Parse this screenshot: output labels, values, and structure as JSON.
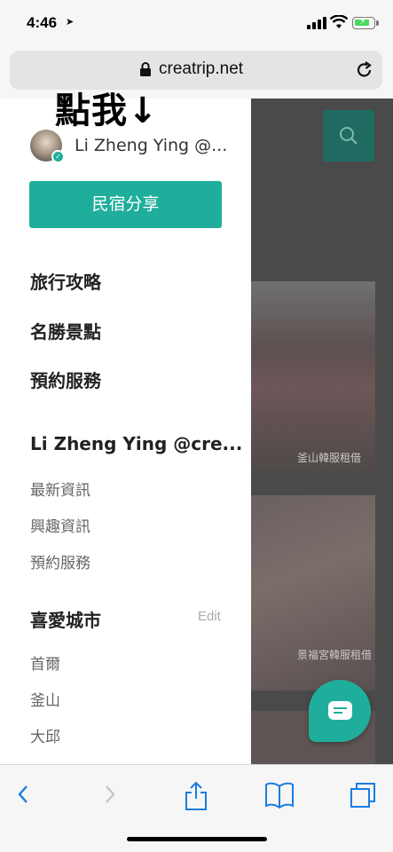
{
  "status_bar": {
    "time": "4:46",
    "battery_level": 0.85,
    "accent_color": "#4cd964"
  },
  "browser": {
    "url": "creatrip.net",
    "lock_icon": "lock-icon",
    "reload_icon": "reload-icon"
  },
  "annotation": "點我↓",
  "drawer": {
    "user_name": "Li Zheng Ying @...",
    "share_button_label": "民宿分享",
    "menu_items": [
      "旅行攻略",
      "名勝景點",
      "預約服務"
    ],
    "account_section": {
      "title": "Li Zheng Ying @cre...",
      "items": [
        "最新資訊",
        "興趣資訊",
        "預約服務"
      ]
    },
    "favorites_section": {
      "title": "喜愛城市",
      "edit_label": "Edit",
      "items": [
        "首爾",
        "釜山",
        "大邱"
      ]
    },
    "brand_color": "#1fae9b"
  },
  "background_page": {
    "cards": [
      {
        "caption": "釜山韓服租借"
      },
      {
        "caption": "景福宮韓服租借"
      }
    ]
  },
  "toolbar": {
    "icons": [
      "back-icon",
      "forward-icon",
      "share-icon",
      "bookmarks-icon",
      "tabs-icon"
    ]
  }
}
